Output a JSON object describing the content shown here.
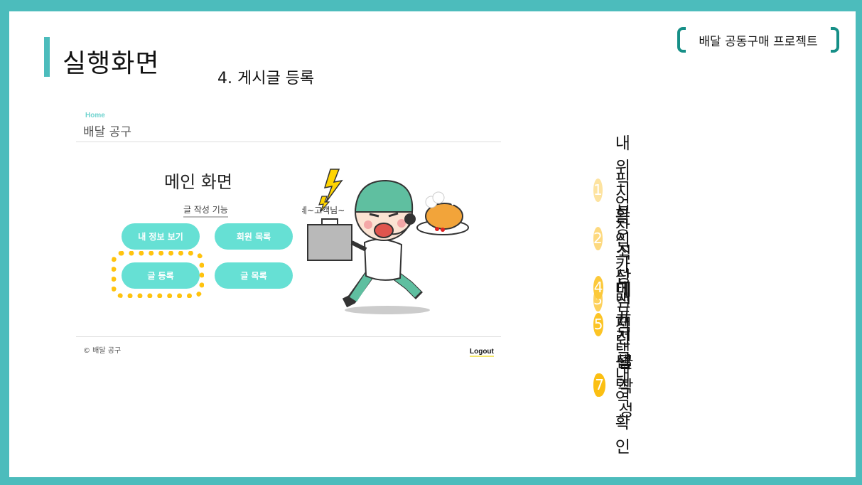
{
  "slide": {
    "title": "실행화면",
    "subtitle": "4. 게시글 등록",
    "project_tag": "배달 공동구매 프로젝트"
  },
  "mock": {
    "home_label": "Home",
    "brand": "배달 공구",
    "main_title": "메인 화면",
    "write_label": "글 작성 기능",
    "buttons": [
      {
        "label": "내 정보 보기"
      },
      {
        "label": "회원 목록"
      },
      {
        "label": "글 등록"
      },
      {
        "label": "글 목록"
      }
    ],
    "copyright": "© 배달 공구",
    "logout": "Logout",
    "illustration_speech": "네~고객님~"
  },
  "steps": [
    {
      "num": "1",
      "label": "내 위치 확인",
      "color": "#fde3a0"
    },
    {
      "num": "2",
      "label": "픽업 장소 선택",
      "color": "#fdd97f"
    },
    {
      "num": "3",
      "label": "음식 카테고리 선택",
      "color": "#fdd15c"
    },
    {
      "num": "4",
      "label": "식당 선택",
      "color": "#fcc93a"
    },
    {
      "num": "5",
      "label": "메뉴 선택",
      "color": "#fcc425"
    },
    {
      "num": "6",
      "label": "선택 내역 확인",
      "color": "#fbc11b"
    },
    {
      "num": "7",
      "label": "글 작성",
      "color": "#fbbf12"
    }
  ],
  "colors": {
    "accent": "#4cbcbc",
    "button": "#66e0d4",
    "highlight": "#ffc30f"
  }
}
